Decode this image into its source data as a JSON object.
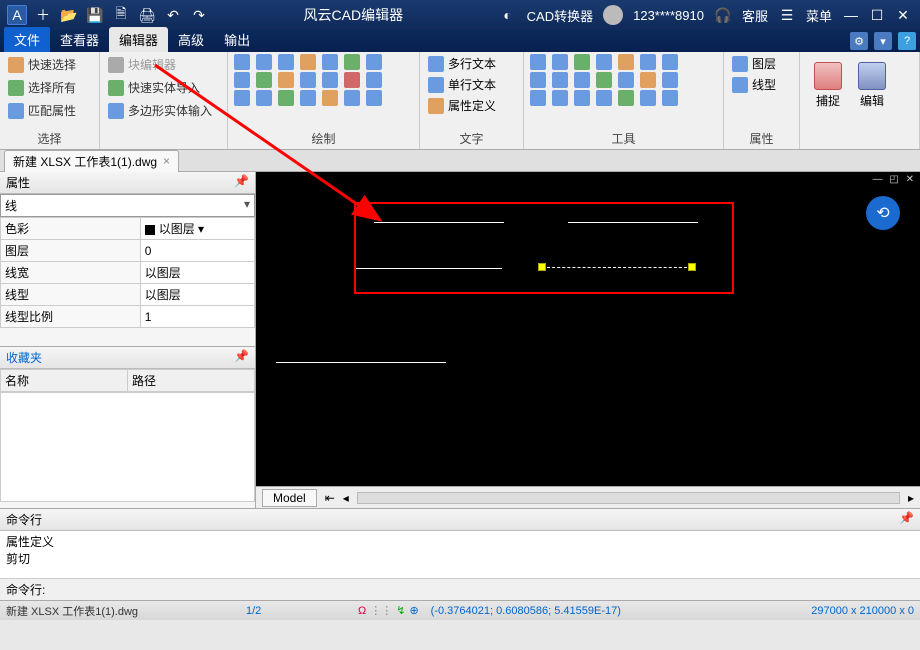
{
  "title": "风云CAD编辑器",
  "titlebar": {
    "converter": "CAD转换器",
    "user": "123****8910",
    "support": "客服",
    "menu": "菜单"
  },
  "menu": {
    "file": "文件",
    "viewer": "查看器",
    "editor": "编辑器",
    "advanced": "高级",
    "output": "输出"
  },
  "ribbon": {
    "select": {
      "quick": "快速选择",
      "all": "选择所有",
      "match": "匹配属性",
      "title": "选择"
    },
    "entity": {
      "blockedit": "块编辑器",
      "fastimport": "快速实体导入",
      "polyimport": "多边形实体输入"
    },
    "draw_title": "绘制",
    "text": {
      "multi": "多行文本",
      "single": "单行文本",
      "attrdef": "属性定义",
      "title": "文字"
    },
    "tools_title": "工具",
    "layer": {
      "layer": "图层",
      "linetype": "线型",
      "title": "属性"
    },
    "snap": "捕捉",
    "edit": "编辑"
  },
  "doc_tab": "新建 XLSX 工作表1(1).dwg",
  "props": {
    "panel_title": "属性",
    "type": "线",
    "rows": {
      "color_k": "色彩",
      "color_v": "以图层",
      "layer_k": "图层",
      "layer_v": "0",
      "lw_k": "线宽",
      "lw_v": "以图层",
      "lt_k": "线型",
      "lt_v": "以图层",
      "lts_k": "线型比例",
      "lts_v": "1"
    }
  },
  "fav": {
    "title": "收藏夹",
    "col_name": "名称",
    "col_path": "路径"
  },
  "model_tab": "Model",
  "cmd": {
    "panel": "命令行",
    "log1": "属性定义",
    "log2": "剪切",
    "prompt": "命令行:"
  },
  "status": {
    "file": "新建 XLSX 工作表1(1).dwg",
    "pages": "1/2",
    "coords": "(-0.3764021; 0.6080586; 5.41559E-17)",
    "dims": "297000 x 210000 x 0"
  }
}
